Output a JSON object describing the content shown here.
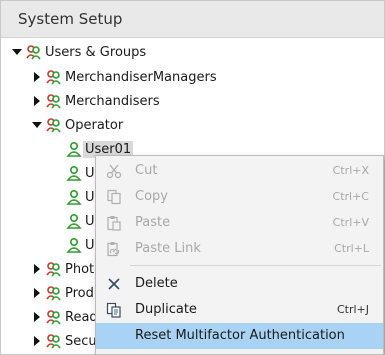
{
  "header": {
    "title": "System Setup"
  },
  "tree": {
    "root": {
      "label": "Users & Groups"
    },
    "groups": [
      {
        "label": "MerchandiserManagers"
      },
      {
        "label": "Merchandisers"
      },
      {
        "label": "Operator"
      }
    ],
    "users": [
      {
        "label": "User01"
      },
      {
        "label": "Us"
      },
      {
        "label": "Us"
      },
      {
        "label": "Us"
      },
      {
        "label": "Us"
      }
    ],
    "lower_groups": [
      {
        "label": "Photo"
      },
      {
        "label": "Produ"
      },
      {
        "label": "Read"
      },
      {
        "label": "Secur"
      }
    ]
  },
  "context_menu": {
    "items": [
      {
        "label": "Cut",
        "shortcut": "Ctrl+X",
        "icon": "scissors-icon",
        "enabled": false
      },
      {
        "label": "Copy",
        "shortcut": "Ctrl+C",
        "icon": "copy-icon",
        "enabled": false
      },
      {
        "label": "Paste",
        "shortcut": "Ctrl+V",
        "icon": "paste-icon",
        "enabled": false
      },
      {
        "label": "Paste Link",
        "shortcut": "Ctrl+L",
        "icon": "paste-link-icon",
        "enabled": false
      },
      {
        "label": "Delete",
        "shortcut": "",
        "icon": "delete-x-icon",
        "enabled": true
      },
      {
        "label": "Duplicate",
        "shortcut": "Ctrl+J",
        "icon": "duplicate-icon",
        "enabled": true
      },
      {
        "label": "Reset Multifactor Authentication",
        "shortcut": "",
        "icon": "",
        "enabled": true,
        "highlighted": true
      }
    ]
  },
  "colors": {
    "highlight": "#a9d3f5",
    "icon_green": "#2e9b2e",
    "icon_red": "#c0392b"
  }
}
